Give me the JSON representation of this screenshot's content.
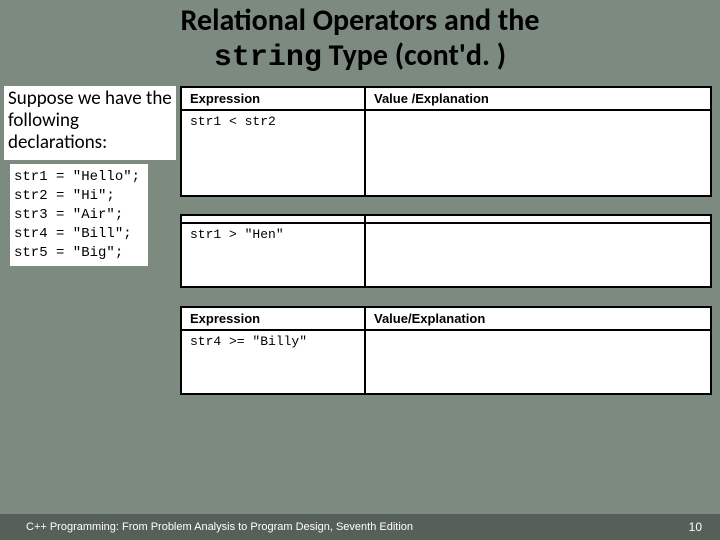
{
  "title": {
    "line1_a": "Relational Operators and the",
    "line2_code": "string",
    "line2_rest": " Type (cont'd. )"
  },
  "intro": "Suppose we have the following declarations:",
  "declarations": "str1 = \"Hello\";\nstr2 = \"Hi\";\nstr3 = \"Air\";\nstr4 = \"Bill\";\nstr5 = \"Big\";",
  "tables": [
    {
      "header": {
        "c1": "Expression",
        "c2": "Value /Explanation"
      },
      "rows": [
        {
          "c1": "str1 < str2",
          "c2": ""
        }
      ]
    },
    {
      "header": {
        "c1": "",
        "c2": ""
      },
      "rows": [
        {
          "c1": "str1 > \"Hen\"",
          "c2": ""
        }
      ]
    },
    {
      "header": {
        "c1": "Expression",
        "c2": "Value/Explanation"
      },
      "rows": [
        {
          "c1": "str4 >= \"Billy\"",
          "c2": ""
        }
      ]
    }
  ],
  "footer": {
    "text": "C++ Programming: From Problem Analysis to Program Design, Seventh Edition",
    "page": "10"
  }
}
